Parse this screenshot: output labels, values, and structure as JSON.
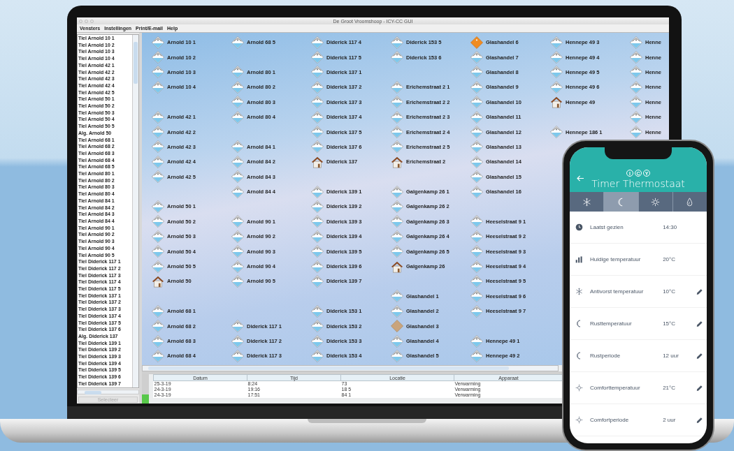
{
  "window": {
    "title": "De Groot Vroomshoop - ICY-CC GUI"
  },
  "menu": [
    "Vensters",
    "Instellingen",
    "Print/E-mail",
    "Help"
  ],
  "sidebar": {
    "items": [
      "Tiel Arnold 10 1",
      "Tiel Arnold 10 2",
      "Tiel Arnold 10 3",
      "Tiel Arnold 10 4",
      "Tiel Arnold 42 1",
      "Tiel Arnold 42 2",
      "Tiel Arnold 42 3",
      "Tiel Arnold 42 4",
      "Tiel Arnold 42 5",
      "Tiel Arnold 50 1",
      "Tiel Arnold 50 2",
      "Tiel Arnold 50 3",
      "Tiel Arnold 50 4",
      "Tiel Arnold 50 5",
      "Alg. Arnold 50",
      "Tiel Arnold 68 1",
      "Tiel Arnold 68 2",
      "Tiel Arnold 68 3",
      "Tiel Arnold 68 4",
      "Tiel Arnold 68 5",
      "Tiel Arnold 80 1",
      "Tiel Arnold 80 2",
      "Tiel Arnold 80 3",
      "Tiel Arnold 80 4",
      "Tiel Arnold 84 1",
      "Tiel Arnold 84 2",
      "Tiel Arnold 84 3",
      "Tiel Arnold 84 4",
      "Tiel Arnold 90 1",
      "Tiel Arnold 90 2",
      "Tiel Arnold 90 3",
      "Tiel Arnold 90 4",
      "Tiel Arnold 90 5",
      "Tiel Diderick 117 1",
      "Tiel Diderick 117 2",
      "Tiel Diderick 117 3",
      "Tiel Diderick 117 4",
      "Tiel Diderick 117 5",
      "Tiel Diderick 137 1",
      "Tiel Diderick 137 2",
      "Tiel Diderick 137 3",
      "Tiel Diderick 137 4",
      "Tiel Diderick 137 5",
      "Tiel Diderick 137 6",
      "Alg. Diderick 137",
      "Tiel Diderick 139 1",
      "Tiel Diderick 139 2",
      "Tiel Diderick 139 3",
      "Tiel Diderick 139 4",
      "Tiel Diderick 139 5",
      "Tiel Diderick 139 6",
      "Tiel Diderick 139 7"
    ],
    "button": {
      "label": "Selecteer",
      "disabled": true
    }
  },
  "grid": {
    "columns": [
      [
        {
          "label": "Arnold 10 1",
          "kind": "sensor"
        },
        {
          "label": "Arnold 10 2",
          "kind": "sensor"
        },
        {
          "label": "Arnold 10 3",
          "kind": "sensor"
        },
        {
          "label": "Arnold 10 4",
          "kind": "sensor"
        },
        null,
        {
          "label": "Arnold 42 1",
          "kind": "sensor"
        },
        {
          "label": "Arnold 42 2",
          "kind": "sensor"
        },
        {
          "label": "Arnold 42 3",
          "kind": "sensor"
        },
        {
          "label": "Arnold 42 4",
          "kind": "sensor"
        },
        {
          "label": "Arnold 42 5",
          "kind": "sensor"
        },
        null,
        {
          "label": "Arnold 50 1",
          "kind": "sensor"
        },
        {
          "label": "Arnold 50 2",
          "kind": "sensor"
        },
        {
          "label": "Arnold 50 3",
          "kind": "sensor"
        },
        {
          "label": "Arnold 50 4",
          "kind": "sensor"
        },
        {
          "label": "Arnold 50 5",
          "kind": "sensor"
        },
        {
          "label": "Arnold 50",
          "kind": "house"
        },
        null,
        {
          "label": "Arnold 68 1",
          "kind": "sensor"
        },
        {
          "label": "Arnold 68 2",
          "kind": "sensor"
        },
        {
          "label": "Arnold 68 3",
          "kind": "sensor"
        },
        {
          "label": "Arnold 68 4",
          "kind": "sensor"
        }
      ],
      [
        {
          "label": "Arnold 68 5",
          "kind": "sensor"
        },
        null,
        {
          "label": "Arnold 80 1",
          "kind": "sensor"
        },
        {
          "label": "Arnold 80 2",
          "kind": "sensor"
        },
        {
          "label": "Arnold 80 3",
          "kind": "sensor"
        },
        {
          "label": "Arnold 80 4",
          "kind": "sensor"
        },
        null,
        {
          "label": "Arnold 84 1",
          "kind": "sensor"
        },
        {
          "label": "Arnold 84 2",
          "kind": "sensor"
        },
        {
          "label": "Arnold 84 3",
          "kind": "sensor"
        },
        {
          "label": "Arnold 84 4",
          "kind": "sensor"
        },
        null,
        {
          "label": "Arnold 90 1",
          "kind": "sensor"
        },
        {
          "label": "Arnold 90 2",
          "kind": "sensor"
        },
        {
          "label": "Arnold 90 3",
          "kind": "sensor"
        },
        {
          "label": "Arnold 90 4",
          "kind": "sensor"
        },
        {
          "label": "Arnold 90 5",
          "kind": "sensor"
        },
        null,
        null,
        {
          "label": "Diderick 117 1",
          "kind": "sensor"
        },
        {
          "label": "Diderick 117 2",
          "kind": "sensor"
        },
        {
          "label": "Diderick 117 3",
          "kind": "sensor"
        }
      ],
      [
        {
          "label": "Diderick 117 4",
          "kind": "sensor"
        },
        {
          "label": "Diderick 117 5",
          "kind": "sensor"
        },
        {
          "label": "Diderick 137 1",
          "kind": "sensor"
        },
        {
          "label": "Diderick 137 2",
          "kind": "sensor"
        },
        {
          "label": "Diderick 137 3",
          "kind": "sensor"
        },
        {
          "label": "Diderick 137 4",
          "kind": "sensor"
        },
        {
          "label": "Diderick 137 5",
          "kind": "sensor"
        },
        {
          "label": "Diderick 137 6",
          "kind": "sensor"
        },
        {
          "label": "Diderick 137",
          "kind": "house"
        },
        null,
        {
          "label": "Diderick 139 1",
          "kind": "sensor"
        },
        {
          "label": "Diderick 139 2",
          "kind": "sensor"
        },
        {
          "label": "Diderick 139 3",
          "kind": "sensor"
        },
        {
          "label": "Diderick 139 4",
          "kind": "sensor"
        },
        {
          "label": "Diderick 139 5",
          "kind": "sensor"
        },
        {
          "label": "Diderick 139 6",
          "kind": "sensor"
        },
        {
          "label": "Diderick 139 7",
          "kind": "sensor"
        },
        null,
        {
          "label": "Diderick 153 1",
          "kind": "sensor"
        },
        {
          "label": "Diderick 153 2",
          "kind": "sensor"
        },
        {
          "label": "Diderick 153 3",
          "kind": "sensor"
        },
        {
          "label": "Diderick 153 4",
          "kind": "sensor"
        }
      ],
      [
        {
          "label": "Diderick 153 5",
          "kind": "sensor"
        },
        {
          "label": "Diderick 153 6",
          "kind": "sensor"
        },
        null,
        {
          "label": "Erichemstraat 2 1",
          "kind": "sensor"
        },
        {
          "label": "Erichemstraat 2 2",
          "kind": "sensor"
        },
        {
          "label": "Erichemstraat 2 3",
          "kind": "sensor"
        },
        {
          "label": "Erichemstraat 2 4",
          "kind": "sensor"
        },
        {
          "label": "Erichemstraat 2 5",
          "kind": "sensor"
        },
        {
          "label": "Erichemstraat 2",
          "kind": "house"
        },
        null,
        {
          "label": "Galgenkamp 26 1",
          "kind": "sensor"
        },
        {
          "label": "Galgenkamp 26 2",
          "kind": "sensor"
        },
        {
          "label": "Galgenkamp 26 3",
          "kind": "sensor"
        },
        {
          "label": "Galgenkamp 26 4",
          "kind": "sensor"
        },
        {
          "label": "Galgenkamp 26 5",
          "kind": "sensor"
        },
        {
          "label": "Galgenkamp 26",
          "kind": "house"
        },
        null,
        {
          "label": "Glashandel 1",
          "kind": "sensor"
        },
        {
          "label": "Glashandel 2",
          "kind": "sensor"
        },
        {
          "label": "Glashandel 3",
          "kind": "inactive"
        },
        {
          "label": "Glashandel 4",
          "kind": "sensor"
        },
        {
          "label": "Glashandel 5",
          "kind": "sensor"
        }
      ],
      [
        {
          "label": "Glashandel 6",
          "kind": "alert"
        },
        {
          "label": "Glashandel 7",
          "kind": "sensor"
        },
        {
          "label": "Glashandel 8",
          "kind": "sensor"
        },
        {
          "label": "Glashandel 9",
          "kind": "sensor"
        },
        {
          "label": "Glashandel 10",
          "kind": "sensor"
        },
        {
          "label": "Glashandel 11",
          "kind": "sensor"
        },
        {
          "label": "Glashandel 12",
          "kind": "sensor"
        },
        {
          "label": "Glashandel 13",
          "kind": "sensor"
        },
        {
          "label": "Glashandel 14",
          "kind": "sensor"
        },
        {
          "label": "Glashandel 15",
          "kind": "sensor"
        },
        {
          "label": "Glashandel 16",
          "kind": "sensor"
        },
        null,
        {
          "label": "Heeselstraat 9 1",
          "kind": "sensor"
        },
        {
          "label": "Heeselstraat 9 2",
          "kind": "sensor"
        },
        {
          "label": "Heeselstraat 9 3",
          "kind": "sensor"
        },
        {
          "label": "Heeselstraat 9 4",
          "kind": "sensor"
        },
        {
          "label": "Heeselstraat 9 5",
          "kind": "sensor"
        },
        {
          "label": "Heeselstraat 9 6",
          "kind": "sensor"
        },
        {
          "label": "Heeselstraat 9 7",
          "kind": "sensor"
        },
        null,
        {
          "label": "Hennepe 49 1",
          "kind": "sensor"
        },
        {
          "label": "Hennepe 49 2",
          "kind": "sensor"
        }
      ],
      [
        {
          "label": "Hennepe 49 3",
          "kind": "sensor"
        },
        {
          "label": "Hennepe 49 4",
          "kind": "sensor"
        },
        {
          "label": "Hennepe 49 5",
          "kind": "sensor"
        },
        {
          "label": "Hennepe 49 6",
          "kind": "sensor"
        },
        {
          "label": "Hennepe 49",
          "kind": "house"
        },
        null,
        {
          "label": "Hennepe 186 1",
          "kind": "sensor"
        }
      ],
      [
        {
          "label": "Henne",
          "kind": "sensor"
        },
        {
          "label": "Henne",
          "kind": "sensor"
        },
        {
          "label": "Henne",
          "kind": "sensor"
        },
        {
          "label": "Henne",
          "kind": "sensor"
        },
        {
          "label": "Henne",
          "kind": "sensor"
        },
        {
          "label": "Henne",
          "kind": "sensor"
        },
        {
          "label": "Henne",
          "kind": "sensor"
        }
      ]
    ]
  },
  "log_table": {
    "columns": [
      "Datum",
      "Tijd",
      "Locatie",
      "Apparaat"
    ],
    "rows": [
      [
        "25-3-19",
        "8:24",
        "73",
        "Verwarming"
      ],
      [
        "24-3-19",
        "19:16",
        "18 5",
        "Verwarming"
      ],
      [
        "24-3-19",
        "17:51",
        "84 1",
        "Verwarming"
      ]
    ]
  },
  "phone": {
    "logo_letters": [
      "I",
      "C",
      "Y"
    ],
    "title": "Timer Thermostaat",
    "tabs": [
      {
        "kind": "snow",
        "selected": false
      },
      {
        "kind": "moon",
        "selected": true
      },
      {
        "kind": "sun",
        "selected": false
      },
      {
        "kind": "drop",
        "selected": false
      }
    ],
    "settings": [
      {
        "kind": "clock",
        "label": "Laatst gezien",
        "value": "14:30",
        "editable": false
      },
      {
        "kind": "bars",
        "label": "Huidige temperatuur",
        "value": "20°C",
        "editable": false
      },
      {
        "kind": "snow",
        "label": "Antivorst temperatuur",
        "value": "10°C",
        "editable": true
      },
      {
        "kind": "moon",
        "label": "Rusttemperatuur",
        "value": "15°C",
        "editable": true
      },
      {
        "kind": "moon",
        "label": "Rustperiode",
        "value": "12 uur",
        "editable": true
      },
      {
        "kind": "sun",
        "label": "Comforttemperatuur",
        "value": "21°C",
        "editable": true
      },
      {
        "kind": "sun",
        "label": "Comfortperiode",
        "value": "2 uur",
        "editable": true
      }
    ]
  }
}
